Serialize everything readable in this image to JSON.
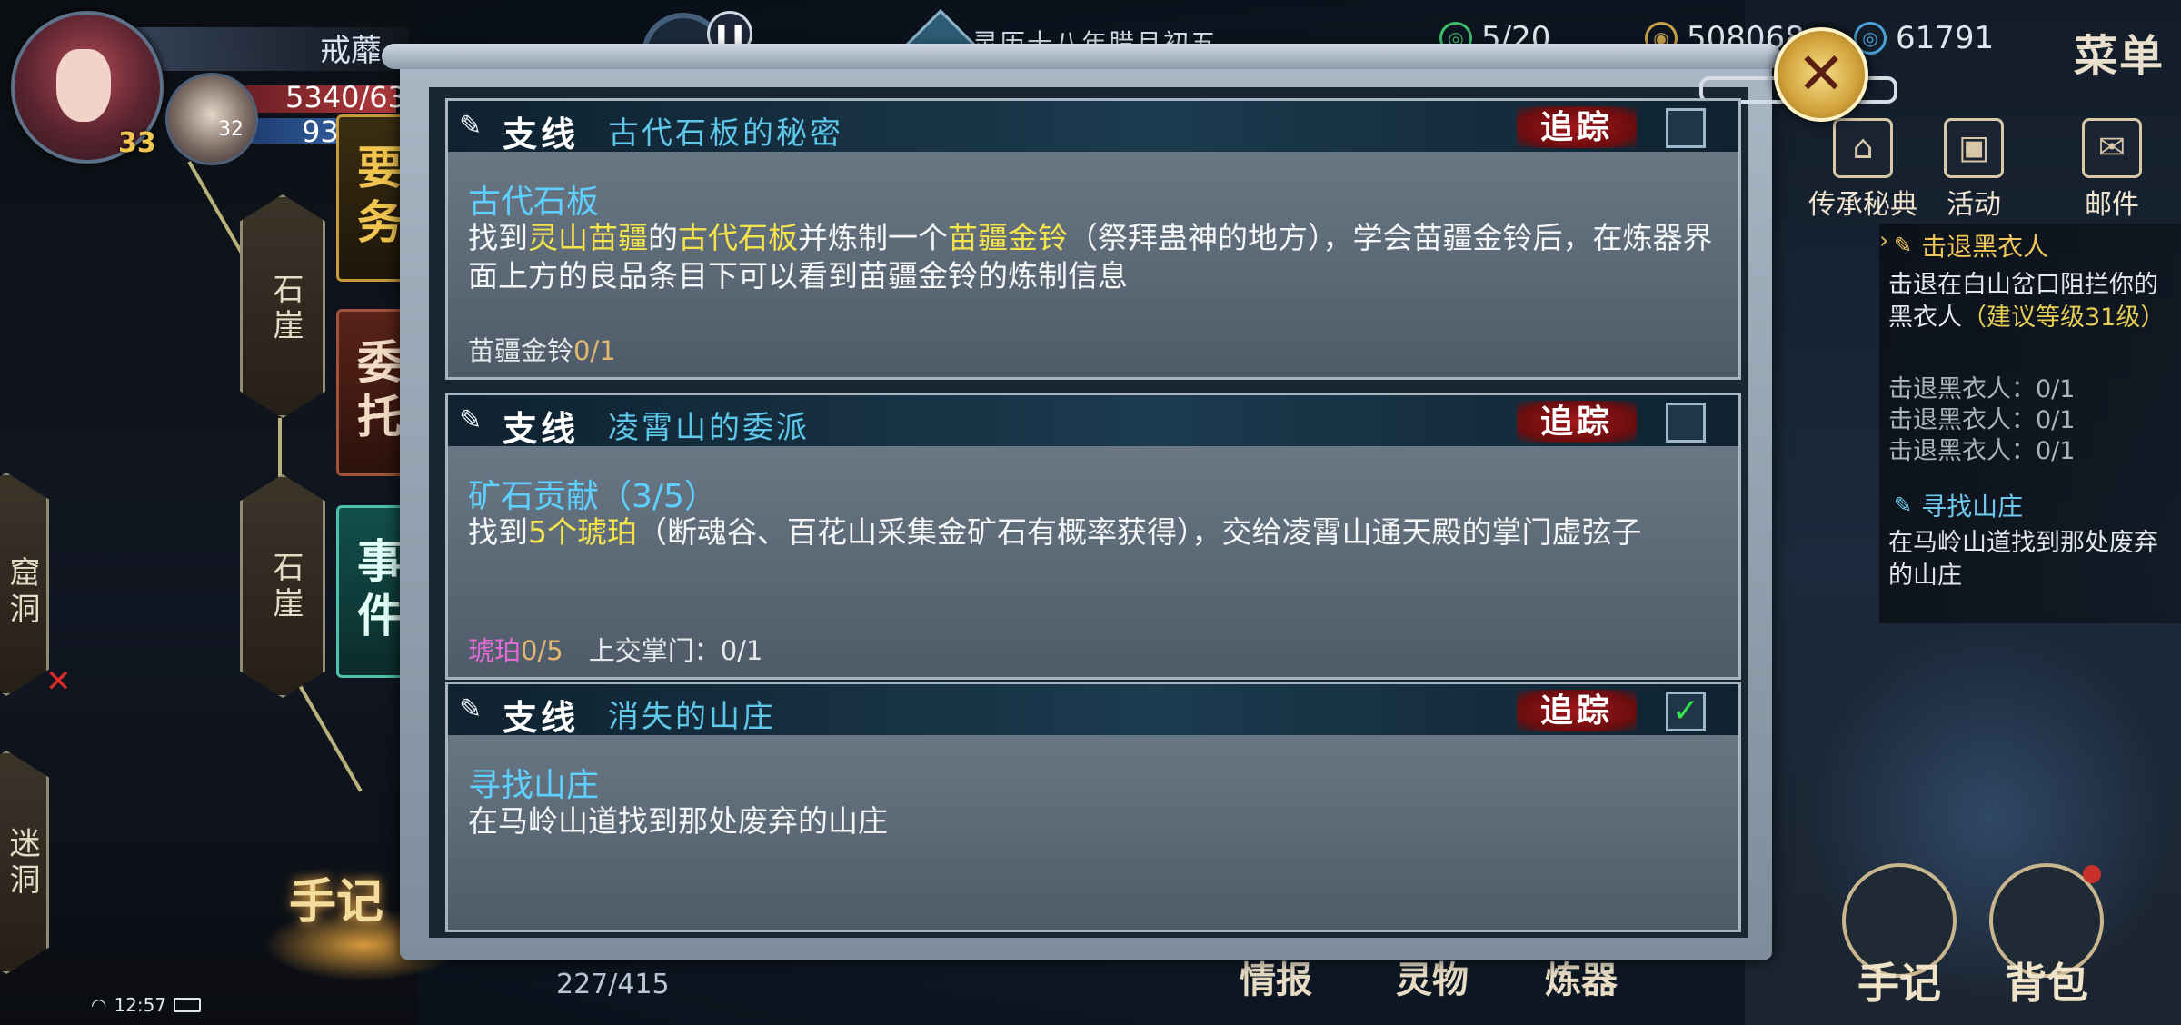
{
  "hud": {
    "player_name": "戒蘼",
    "player_level": "33",
    "companion_level": "32",
    "hp": "5340/63",
    "mp": "93",
    "date": "灵历十八年腊月初五",
    "stamina": "5/20",
    "coins": "508068",
    "jade": "61791",
    "menu": "菜单"
  },
  "top_icons": {
    "codex": "传承秘典",
    "events": "活动",
    "mail": "邮件"
  },
  "tracker": {
    "q1_title": "击退黑衣人",
    "q1_desc": "击退在白山岔口阻拦你的黑衣人",
    "q1_hint": "（建议等级31级）",
    "q1_lines": [
      "击退黑衣人：0/1",
      "击退黑衣人：0/1",
      "击退黑衣人：0/1"
    ],
    "q2_title": "寻找山庄",
    "q2_desc": "在马岭山道找到那处废弃的山庄"
  },
  "map": {
    "node1": "石崖",
    "node2": "石崖",
    "node3": "窟洞",
    "node4": "迷洞"
  },
  "tabs": {
    "main": "要务",
    "commission": "委托",
    "events": "事件"
  },
  "journal": "手记",
  "status": {
    "time": "12:57",
    "exp": "227/415"
  },
  "bottom_nav": {
    "info": "情报",
    "pet": "灵物",
    "craft": "炼器",
    "journal": "手记",
    "bag": "背包"
  },
  "quests": [
    {
      "type": "支线",
      "name": "古代石板的秘密",
      "track": "追踪",
      "tracked": false,
      "subtitle": "古代石板",
      "desc": [
        "找到",
        "灵山苗疆",
        "的",
        "古代石板",
        "并炼制一个",
        "苗疆金铃",
        "（祭拜蛊神的地方），学会苗疆金铃后，在炼器界面上方的良品条目下可以看到苗疆金铃的炼制信息"
      ],
      "progress_label": "苗疆金铃",
      "progress_value": "0/1"
    },
    {
      "type": "支线",
      "name": "凌霄山的委派",
      "track": "追踪",
      "tracked": false,
      "subtitle": "矿石贡献（3/5）",
      "desc": [
        "找到",
        "5个琥珀",
        "（断魂谷、百花山采集金矿石有概率获得），交给凌霄山通天殿的掌门虚弦子"
      ],
      "progress_label": "琥珀",
      "progress_value": "0/5",
      "progress_label2": "上交掌门：0/1"
    },
    {
      "type": "支线",
      "name": "消失的山庄",
      "track": "追踪",
      "tracked": true,
      "check": "✓",
      "subtitle": "寻找山庄",
      "desc": "在马岭山道找到那处废弃的山庄"
    }
  ]
}
